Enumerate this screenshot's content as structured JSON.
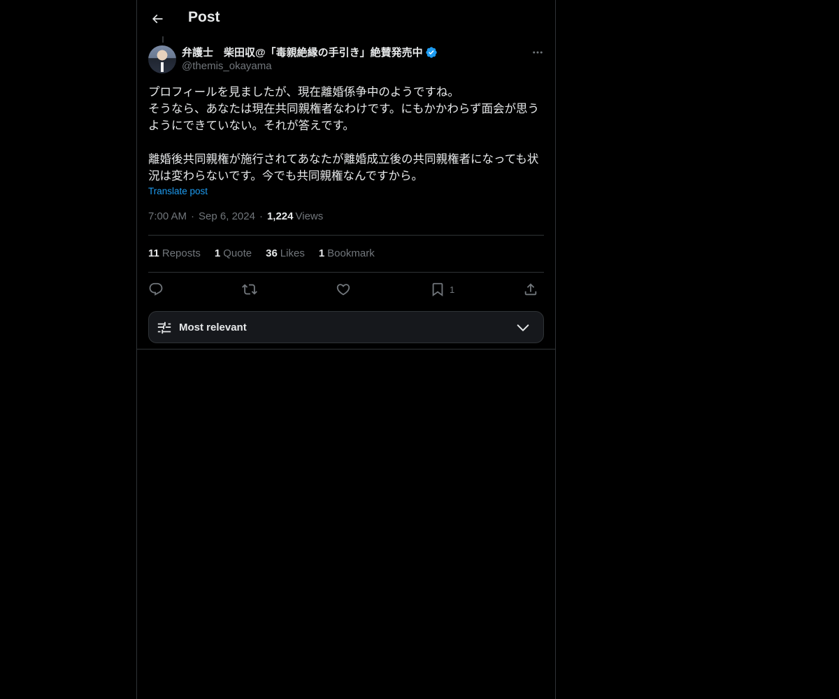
{
  "header": {
    "title": "Post",
    "back_icon": "arrow-left-icon"
  },
  "author": {
    "display_name": "弁護士　柴田収@「毒親絶縁の手引き」絶賛発売中",
    "handle": "@themis_okayama",
    "verified": true,
    "verified_color": "#1d9bf0"
  },
  "post": {
    "text": "プロフィールを見ましたが、現在離婚係争中のようですね。\nそうなら、あなたは現在共同親権者なわけです。にもかかわらず面会が思うようにできていない。それが答えです。\n\n離婚後共同親権が施行されてあなたが離婚成立後の共同親権者になっても状況は変わらないです。今でも共同親権なんですから。",
    "translate_label": "Translate post",
    "time": "7:00 AM",
    "date": "Sep 6, 2024",
    "separator": "·",
    "views_count": "1,224",
    "views_label": "Views"
  },
  "stats": [
    {
      "count": "11",
      "label": "Reposts"
    },
    {
      "count": "1",
      "label": "Quote"
    },
    {
      "count": "36",
      "label": "Likes"
    },
    {
      "count": "1",
      "label": "Bookmark"
    }
  ],
  "actions": {
    "reply_icon": "reply-icon",
    "repost_icon": "repost-icon",
    "like_icon": "heart-icon",
    "bookmark_icon": "bookmark-icon",
    "bookmark_count": "1",
    "share_icon": "share-icon"
  },
  "sort": {
    "label": "Most relevant",
    "icon": "sliders-icon",
    "chevron": "chevron-down-icon"
  },
  "colors": {
    "background": "#000000",
    "text": "#e7e9ea",
    "muted": "#71767b",
    "accent": "#1d9bf0",
    "border": "#2f3336"
  }
}
